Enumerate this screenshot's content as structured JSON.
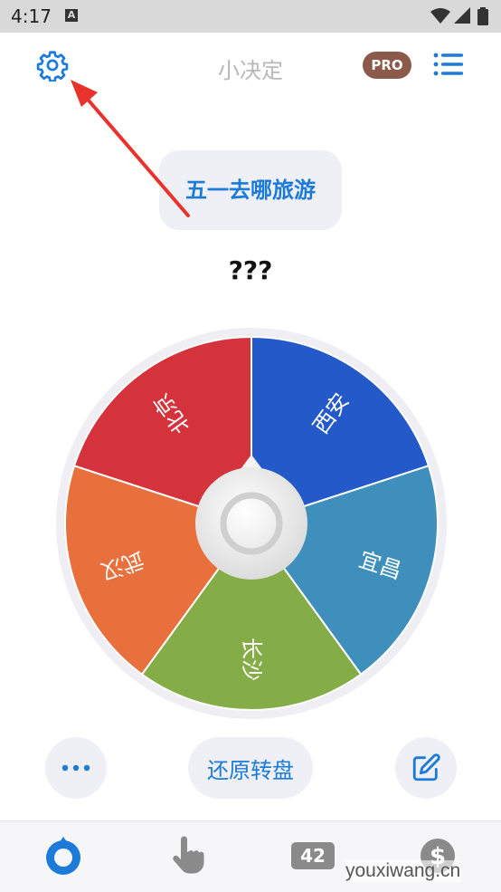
{
  "status_bar": {
    "time": "4:17",
    "notification_icon": "A"
  },
  "app_bar": {
    "title": "小决定",
    "pro_label": "PRO",
    "settings_icon": "gear-icon",
    "menu_icon": "list-icon"
  },
  "question": "五一去哪旅游",
  "result": "???",
  "wheel": {
    "segments": [
      {
        "label": "西安",
        "color": "#2459c9"
      },
      {
        "label": "宜昌",
        "color": "#3f8fbd"
      },
      {
        "label": "长沙",
        "color": "#84ad48"
      },
      {
        "label": "武汉",
        "color": "#e8703d"
      },
      {
        "label": "北京",
        "color": "#d5333c"
      }
    ]
  },
  "actions": {
    "more_icon": "more-dots-icon",
    "reset_label": "还原转盘",
    "edit_icon": "edit-icon"
  },
  "tabbar": {
    "wheel_icon": "wheel-icon",
    "tap_icon": "hand-pointer-icon",
    "number_label": "42",
    "coin_icon": "dollar-coin-icon"
  },
  "watermark": "youxiwang.cn",
  "colors": {
    "accent": "#1c7ad9",
    "pro": "#8b5a4a",
    "annotation_arrow": "#e8322b"
  }
}
